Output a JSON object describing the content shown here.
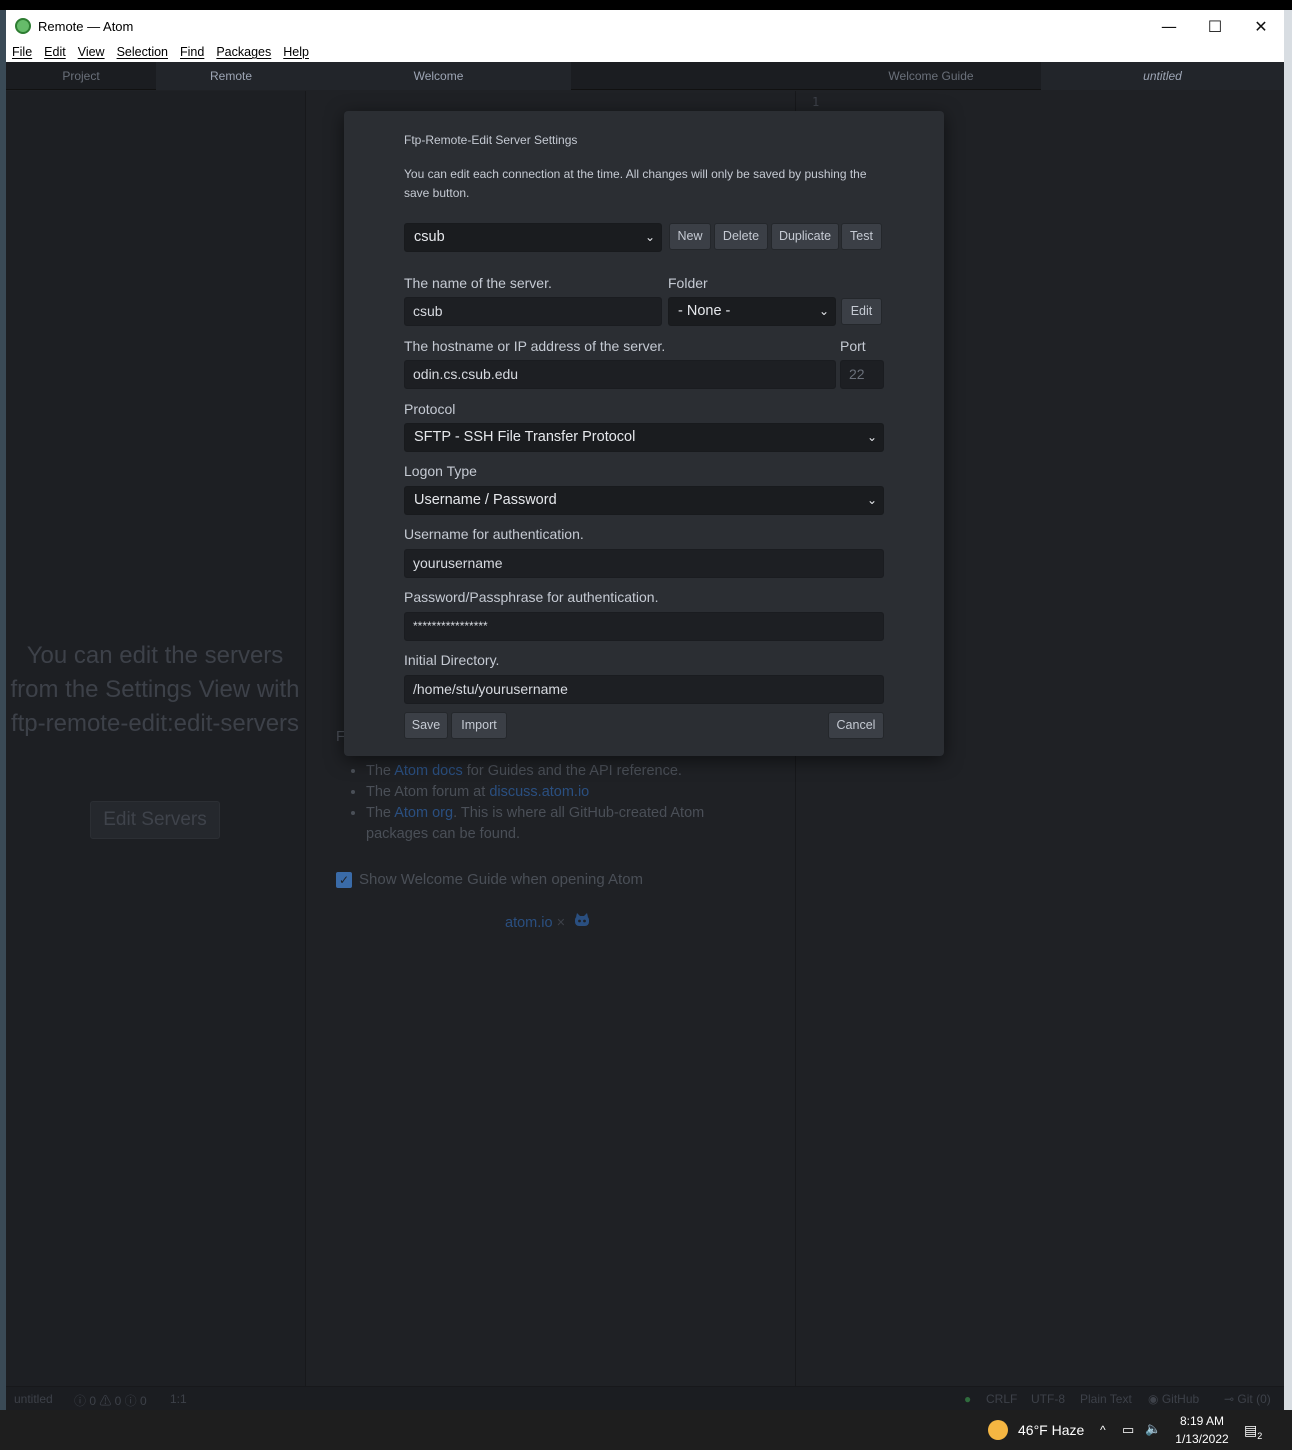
{
  "window": {
    "title": "Remote — Atom",
    "controls": {
      "minimize": "—",
      "maximize": "☐",
      "close": "✕"
    }
  },
  "menu": [
    "File",
    "Edit",
    "View",
    "Selection",
    "Find",
    "Packages",
    "Help"
  ],
  "tabs": {
    "project": "Project",
    "remote": "Remote",
    "welcome": "Welcome",
    "welcome_guide": "Welcome Guide",
    "untitled": "untitled"
  },
  "left_pane": {
    "message": "You can edit the servers from the Settings View with ftp-remote-edit:edit-servers",
    "edit_servers_button": "Edit Servers"
  },
  "welcome": {
    "stub": "F",
    "list": [
      {
        "pre": "The ",
        "link": "Atom docs",
        "post": " for Guides and the API reference."
      },
      {
        "pre": "The Atom forum at ",
        "link": "discuss.atom.io",
        "post": ""
      },
      {
        "pre": "The ",
        "link": "Atom org",
        "post": ". This is where all GitHub-created Atom packages can be found."
      }
    ],
    "show_guide_label": "Show Welcome Guide when opening Atom",
    "footer_link": "atom.io",
    "footer_sep": "×"
  },
  "editor": {
    "line_number": "1"
  },
  "modal": {
    "title": "Ftp-Remote-Edit Server Settings",
    "description": "You can edit each connection at the time. All changes will only be saved by pushing the save button.",
    "server_select": "csub",
    "buttons": {
      "new": "New",
      "delete": "Delete",
      "duplicate": "Duplicate",
      "test": "Test",
      "edit": "Edit",
      "save": "Save",
      "import": "Import",
      "cancel": "Cancel"
    },
    "name_label": "The name of the server.",
    "name_value": "csub",
    "folder_label": "Folder",
    "folder_select": "- None -",
    "host_label": "The hostname or IP address of the server.",
    "host_value": "odin.cs.csub.edu",
    "port_label": "Port",
    "port_value": "22",
    "protocol_label": "Protocol",
    "protocol_select": "SFTP - SSH File Transfer Protocol",
    "logon_label": "Logon Type",
    "logon_select": "Username / Password",
    "username_label": "Username for authentication.",
    "username_value": "yourusername",
    "password_label": "Password/Passphrase for authentication.",
    "password_value": "****************",
    "directory_label": "Initial Directory.",
    "directory_value": "/home/stu/yourusername"
  },
  "statusbar": {
    "file": "untitled",
    "diagnostics": "ⓘ 0 ⚠ 0 ⓘ 0",
    "cursor": "1:1",
    "line_ending": "CRLF",
    "encoding": "UTF-8",
    "grammar": "Plain Text",
    "github": "GitHub",
    "git": "Git (0)"
  },
  "taskbar": {
    "weather": "46°F  Haze",
    "time": "8:19 AM",
    "date": "1/13/2022",
    "notifications": "2"
  }
}
